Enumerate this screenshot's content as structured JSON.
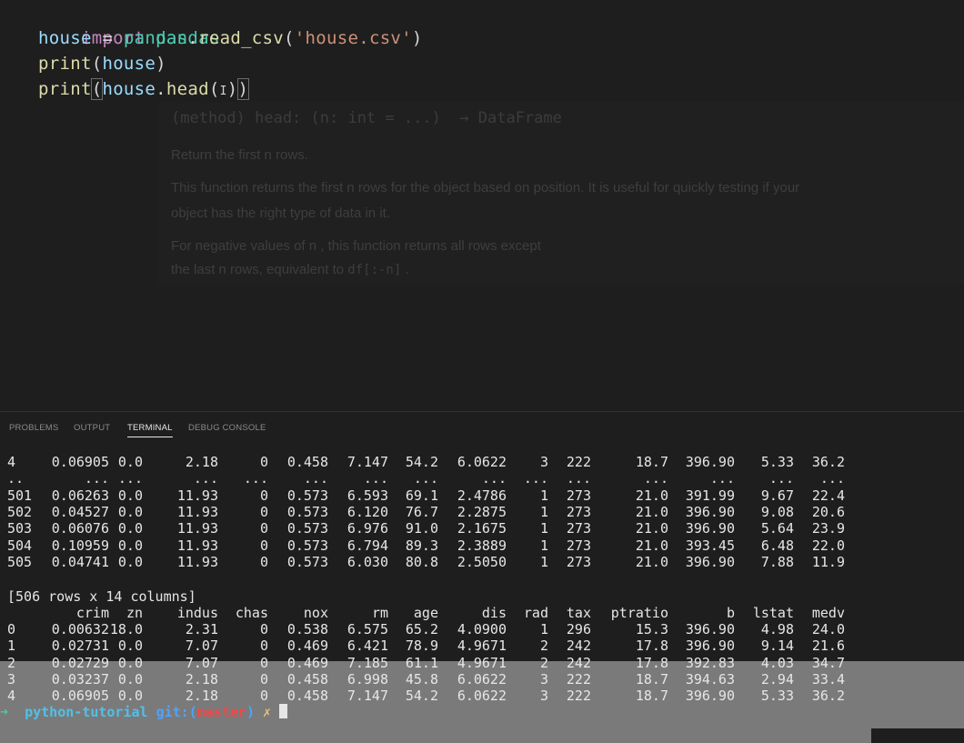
{
  "editor": {
    "line1": {
      "kw": "import",
      "mod": "pandas"
    },
    "line2": {
      "var": "house",
      "eq": " = ",
      "mod": "pandas",
      "dot": ".",
      "fn": "read_csv",
      "open": "(",
      "str": "'house.csv'",
      "close": ")"
    },
    "line3": {
      "fn": "print",
      "open": "(",
      "var": "house",
      "close": ")"
    },
    "line4": {
      "fn": "print",
      "open": "(",
      "var": "house",
      "dot": ".",
      "fn2": "head",
      "open2": "(",
      "cursor": "I",
      "close2": ")",
      "close": ")"
    }
  },
  "hover": {
    "signature": "(method) head: (n: int = ...)  → DataFrame",
    "p1": "Return the first  n  rows.",
    "p2a": "This function returns the first  n  rows for the object based on position. It is useful for quickly testing if your",
    "p2b": "object has the right type of data in it.",
    "p3a": "For negative values of  n , this function returns all rows except",
    "p3b_pre": "the last  n  rows, equivalent to ",
    "p3b_code": "df[:-n]",
    "p3b_post": " ."
  },
  "panel": {
    "tabs": [
      "PROBLEMS",
      "OUTPUT",
      "TERMINAL",
      "DEBUG CONSOLE"
    ],
    "active_tab": "TERMINAL"
  },
  "terminal": {
    "top_rows": [
      [
        "4",
        "0.06905",
        "0.0",
        "2.18",
        "0",
        "0.458",
        "7.147",
        "54.2",
        "6.0622",
        "3",
        "222",
        "18.7",
        "396.90",
        "5.33",
        "36.2"
      ],
      [
        "..",
        "...",
        "...",
        "...",
        "...",
        "...",
        "...",
        "...",
        "...",
        "...",
        "...",
        "...",
        "...",
        "...",
        "..."
      ],
      [
        "501",
        "0.06263",
        "0.0",
        "11.93",
        "0",
        "0.573",
        "6.593",
        "69.1",
        "2.4786",
        "1",
        "273",
        "21.0",
        "391.99",
        "9.67",
        "22.4"
      ],
      [
        "502",
        "0.04527",
        "0.0",
        "11.93",
        "0",
        "0.573",
        "6.120",
        "76.7",
        "2.2875",
        "1",
        "273",
        "21.0",
        "396.90",
        "9.08",
        "20.6"
      ],
      [
        "503",
        "0.06076",
        "0.0",
        "11.93",
        "0",
        "0.573",
        "6.976",
        "91.0",
        "2.1675",
        "1",
        "273",
        "21.0",
        "396.90",
        "5.64",
        "23.9"
      ],
      [
        "504",
        "0.10959",
        "0.0",
        "11.93",
        "0",
        "0.573",
        "6.794",
        "89.3",
        "2.3889",
        "1",
        "273",
        "21.0",
        "393.45",
        "6.48",
        "22.0"
      ],
      [
        "505",
        "0.04741",
        "0.0",
        "11.93",
        "0",
        "0.573",
        "6.030",
        "80.8",
        "2.5050",
        "1",
        "273",
        "21.0",
        "396.90",
        "7.88",
        "11.9"
      ]
    ],
    "summary": "[506 rows x 14 columns]",
    "head_columns": [
      "crim",
      "zn",
      "indus",
      "chas",
      "nox",
      "rm",
      "age",
      "dis",
      "rad",
      "tax",
      "ptratio",
      "b",
      "lstat",
      "medv"
    ],
    "head_rows": [
      [
        "0",
        "0.00632",
        "18.0",
        "2.31",
        "0",
        "0.538",
        "6.575",
        "65.2",
        "4.0900",
        "1",
        "296",
        "15.3",
        "396.90",
        "4.98",
        "24.0"
      ],
      [
        "1",
        "0.02731",
        "0.0",
        "7.07",
        "0",
        "0.469",
        "6.421",
        "78.9",
        "4.9671",
        "2",
        "242",
        "17.8",
        "396.90",
        "9.14",
        "21.6"
      ],
      [
        "2",
        "0.02729",
        "0.0",
        "7.07",
        "0",
        "0.469",
        "7.185",
        "61.1",
        "4.9671",
        "2",
        "242",
        "17.8",
        "392.83",
        "4.03",
        "34.7"
      ],
      [
        "3",
        "0.03237",
        "0.0",
        "2.18",
        "0",
        "0.458",
        "6.998",
        "45.8",
        "6.0622",
        "3",
        "222",
        "18.7",
        "394.63",
        "2.94",
        "33.4"
      ],
      [
        "4",
        "0.06905",
        "0.0",
        "2.18",
        "0",
        "0.458",
        "7.147",
        "54.2",
        "6.0622",
        "3",
        "222",
        "18.7",
        "396.90",
        "5.33",
        "36.2"
      ]
    ],
    "prompt": {
      "arrow": "➜",
      "dir": "python-tutorial",
      "git": "git:(",
      "branch": "master",
      "git_close": ")",
      "dirty": "✗"
    }
  }
}
